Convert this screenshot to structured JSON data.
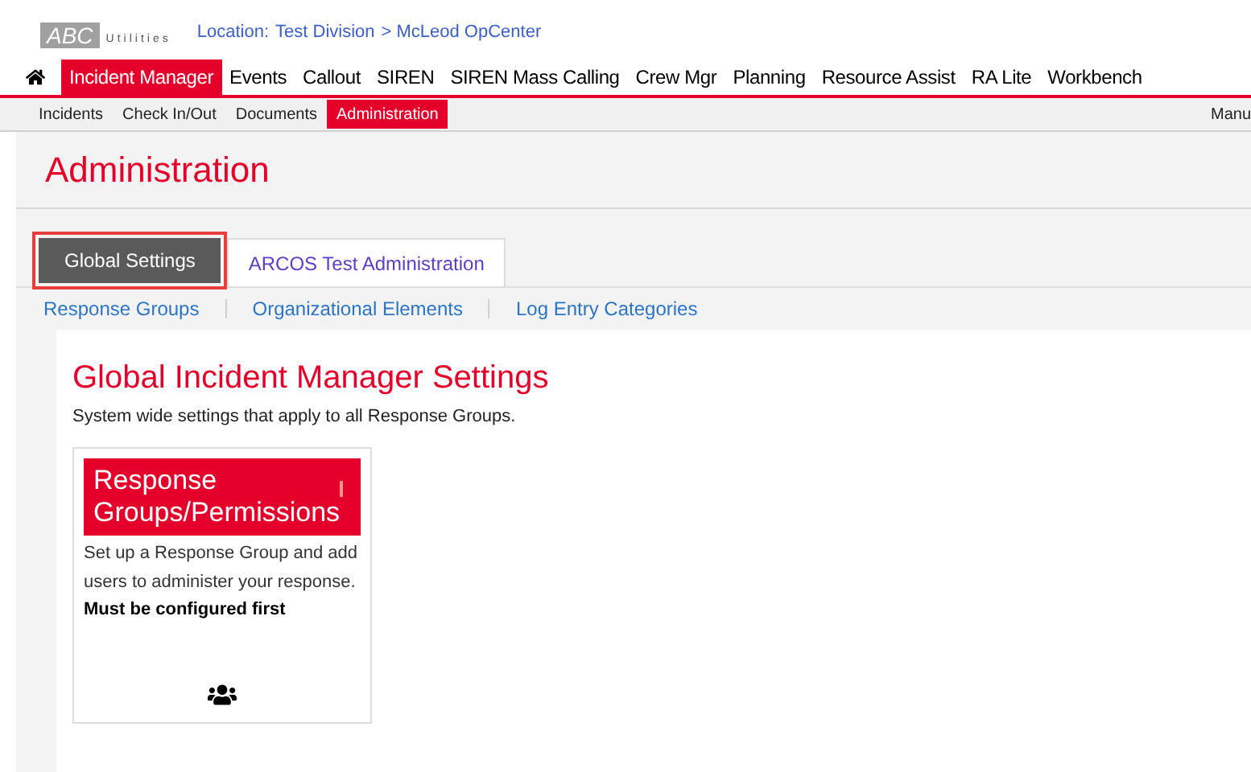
{
  "header": {
    "logo_text": "ABC",
    "logo_sub": "Utilities",
    "location_label": "Location:",
    "location_parts": [
      "Test Division",
      "> McLeod OpCenter"
    ]
  },
  "main_nav": [
    {
      "label": "Incident Manager",
      "selected": true
    },
    {
      "label": "Events",
      "selected": false
    },
    {
      "label": "Callout",
      "selected": false
    },
    {
      "label": "SIREN",
      "selected": false
    },
    {
      "label": "SIREN Mass Calling",
      "selected": false
    },
    {
      "label": "Crew Mgr",
      "selected": false
    },
    {
      "label": "Planning",
      "selected": false
    },
    {
      "label": "Resource Assist",
      "selected": false
    },
    {
      "label": "RA Lite",
      "selected": false
    },
    {
      "label": "Workbench",
      "selected": false
    }
  ],
  "sub_nav": [
    {
      "label": "Incidents",
      "selected": false
    },
    {
      "label": "Check In/Out",
      "selected": false
    },
    {
      "label": "Documents",
      "selected": false
    },
    {
      "label": "Administration",
      "selected": true
    }
  ],
  "sub_nav_right": "Manu",
  "page_title": "Administration",
  "tabs": [
    {
      "label": "Global Settings",
      "selected": true
    },
    {
      "label": "ARCOS Test Administration",
      "selected": false
    }
  ],
  "links": [
    "Response Groups",
    "Organizational Elements",
    "Log Entry Categories"
  ],
  "section": {
    "title": "Global Incident Manager Settings",
    "subtitle": "System wide settings that apply to all Response Groups."
  },
  "cards": [
    {
      "title": "Response Groups/Permissions",
      "description": "Set up a Response Group and add users to administer your response.",
      "note": "Must be configured first"
    }
  ]
}
